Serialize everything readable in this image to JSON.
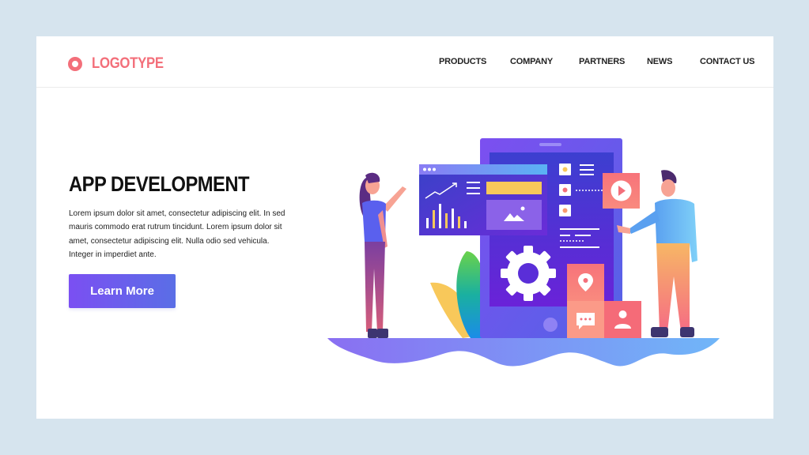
{
  "header": {
    "logo_text": "LOGOTYPE",
    "nav": [
      "PRODUCTS",
      "COMPANY",
      "PARTNERS",
      "NEWS",
      "CONTACT US"
    ]
  },
  "hero": {
    "title": "APP DEVELOPMENT",
    "body": "Lorem ipsum dolor sit amet, consectetur adipiscing elit. In sed mauris commodo erat rutrum tincidunt. Lorem ipsum dolor sit amet, consectetur adipiscing elit. Nulla  odio sed vehicula. Integer in imperdiet ante.",
    "cta_label": "Learn More"
  },
  "illustration": {
    "subject": "app development team with smartphone and dashboard",
    "icons": [
      "trend-chart-icon",
      "image-icon",
      "gear-icon",
      "play-icon",
      "location-pin-icon",
      "chat-bubble-icon",
      "user-icon"
    ]
  },
  "colors": {
    "brand": "#f36f7a",
    "primary": "#6a5cf0",
    "background": "#d6e4ee",
    "text": "#111111"
  }
}
